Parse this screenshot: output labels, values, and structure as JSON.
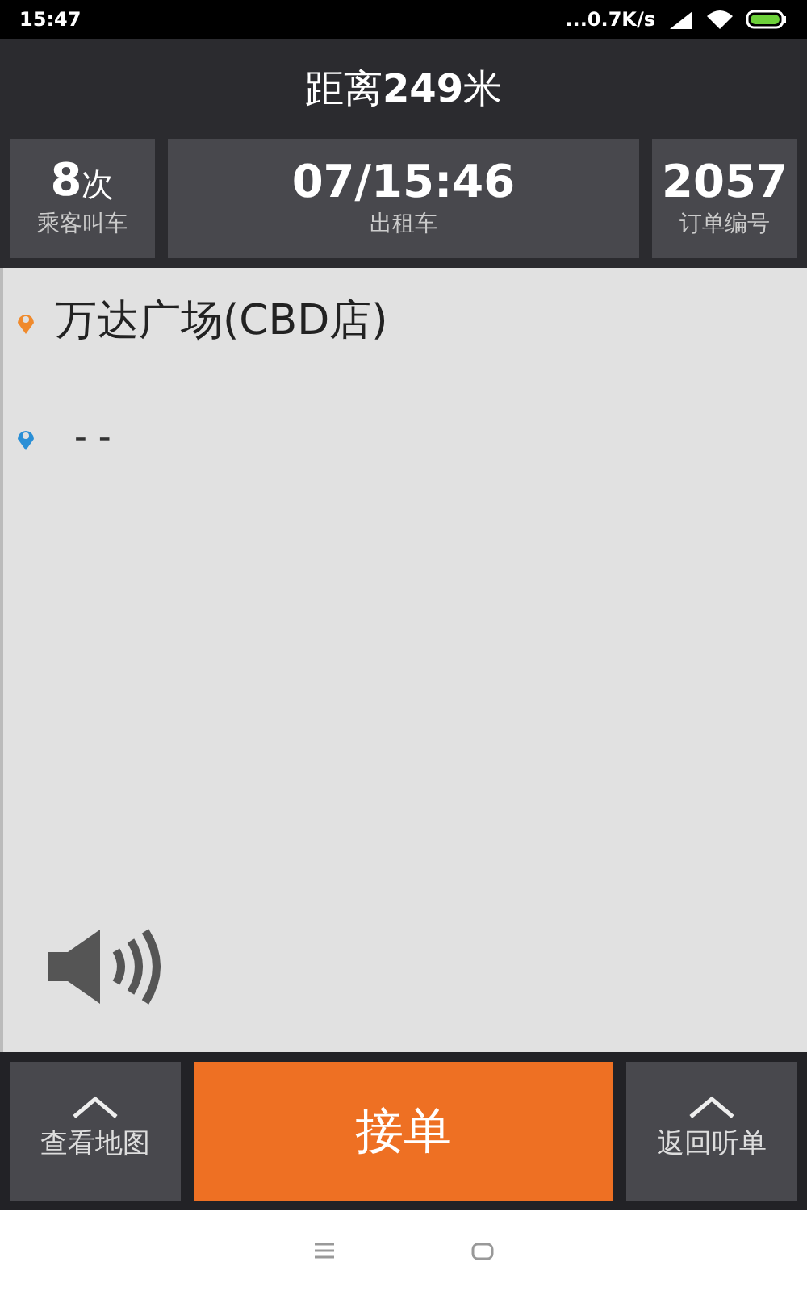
{
  "status_bar": {
    "time": "15:47",
    "network_speed": "...0.7K/s"
  },
  "distance": "距离**249**米",
  "tiles": [
    {
      "value": "8",
      "unit": "次",
      "label": "乘客叫车"
    },
    {
      "value": "07/15:46",
      "label": "出租车"
    },
    {
      "value": "2057",
      "label": "订单编号"
    }
  ],
  "addresses": [
    {
      "kind": "start",
      "text": "万达广场(CBD店)"
    },
    {
      "kind": "end",
      "text": "- -"
    }
  ],
  "bottom_bar": {
    "left": "查看地图",
    "main": "接单",
    "right": "返回听单"
  }
}
